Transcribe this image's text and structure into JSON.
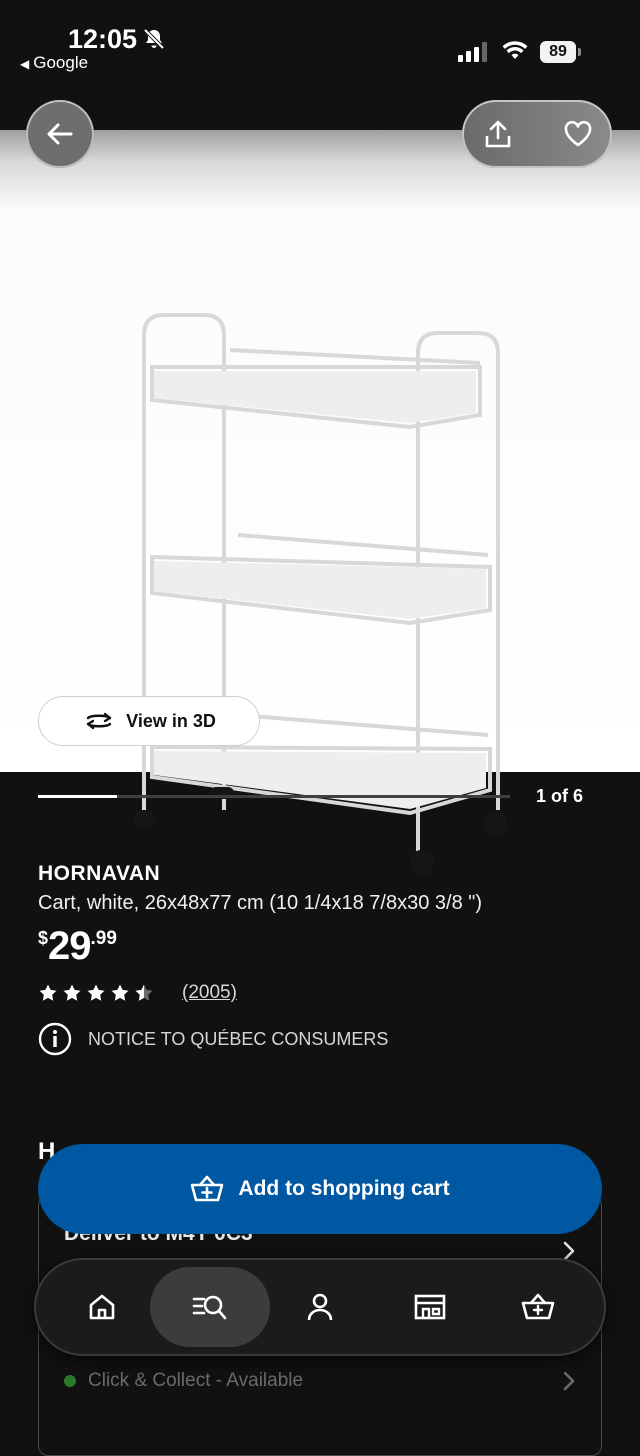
{
  "status_bar": {
    "time": "12:05",
    "back_app": "Google",
    "battery": "89"
  },
  "product": {
    "name": "HORNAVAN",
    "description": "Cart, white, 26x48x77 cm (10 1/4x18 7/8x30 3/8 \")",
    "price_currency": "$",
    "price_whole": "29",
    "price_decimal": ".99",
    "rating": 4.5,
    "rating_max": 5,
    "reviews_count": "(2005)",
    "notice": "NOTICE TO QUÉBEC CONSUMERS"
  },
  "gallery": {
    "view_3d_label": "View in 3D",
    "counter": "1 of 6",
    "progress_fraction": 0.167
  },
  "section_peek": {
    "heading_partial": "H"
  },
  "delivery": {
    "deliver_to": "Deliver to M4Y 0C3",
    "click_collect": "Click & Collect - Available"
  },
  "cta": {
    "add_to_cart": "Add to shopping cart",
    "color": "#0058a3"
  },
  "tabbar": {
    "items": [
      {
        "icon": "home-icon"
      },
      {
        "icon": "search-icon",
        "active": true
      },
      {
        "icon": "profile-icon"
      },
      {
        "icon": "store-icon"
      },
      {
        "icon": "cart-icon"
      }
    ]
  }
}
